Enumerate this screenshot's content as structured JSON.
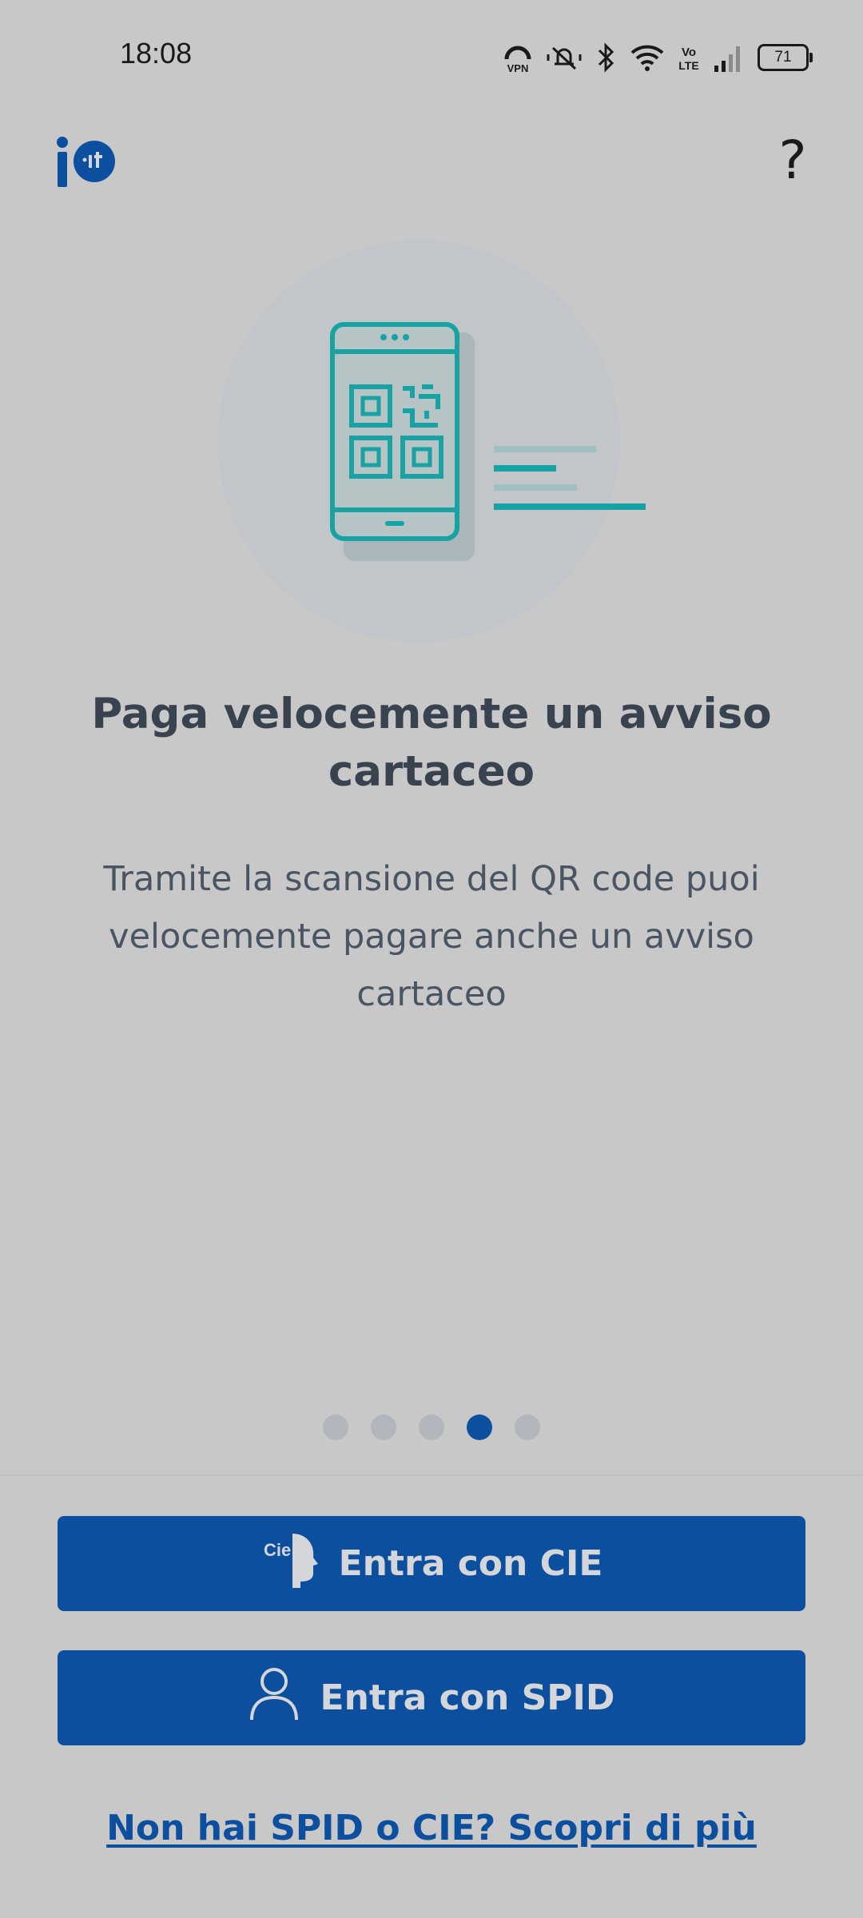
{
  "status_bar": {
    "time": "18:08",
    "battery_level": "71",
    "icons": [
      "vpn-icon",
      "muted-bell-icon",
      "bluetooth-icon",
      "wifi-icon",
      "volte-icon",
      "signal-icon",
      "battery-icon"
    ],
    "vpn_label": "VPN",
    "volte_label": "Vo LTE"
  },
  "header": {
    "logo_text": "io.it",
    "help_label": "?"
  },
  "slide": {
    "title": "Paga velocemente un avviso cartaceo",
    "body": "Tramite la scansione del QR code puoi velocemente pagare anche un avviso cartaceo",
    "illustration_icon": "phone-qr-code-icon"
  },
  "pagination": {
    "total": 5,
    "active_index": 3
  },
  "actions": {
    "cie_label": "Entra con CIE",
    "cie_icon_text": "Cie ID",
    "spid_label": "Entra con SPID",
    "more_link": "Non hai SPID o CIE? Scopri di più"
  },
  "colors": {
    "primary": "#0b4f9e",
    "teal": "#17a2a4",
    "background": "#c8c8c8",
    "title_text": "#39434f"
  }
}
